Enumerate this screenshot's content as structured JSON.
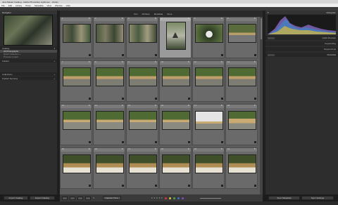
{
  "window": {
    "title": "Jens Master Catalog - Adobe Photoshop Lightroom - Library"
  },
  "menu": [
    "File",
    "Edit",
    "Library",
    "Photo",
    "Metadata",
    "View",
    "Window",
    "Help"
  ],
  "navigator": {
    "title": "Navigator"
  },
  "catalog": {
    "title": "Catalog",
    "items": [
      {
        "label": "All Photographs",
        "count": "",
        "sel": true
      },
      {
        "label": "Quick Collection +",
        "count": ""
      },
      {
        "label": "Previous Import",
        "count": ""
      }
    ]
  },
  "panels": {
    "folders": "Folders",
    "collections": "Collections",
    "publish": "Publish Services"
  },
  "filter": {
    "labels": [
      "Text",
      "Attribute",
      "Metadata",
      "None"
    ]
  },
  "right": {
    "histogram": "Histogram",
    "quick_develop": "Quick Develop",
    "keywording": "Keywording",
    "keyword_list": "Keyword List",
    "metadata": "Metadata"
  },
  "buttons": {
    "import": "Import Catalog",
    "export": "Export Catalog",
    "sync": "Sync Metadata",
    "sync_settings": "Sync Settings",
    "sort": "Capture Time"
  },
  "colors": {
    "accent": "#5e8bd1",
    "select": "#9a9a9a"
  },
  "grid": {
    "rows": [
      [
        {
          "n": "1"
        },
        {
          "n": "2"
        },
        {
          "n": "3"
        },
        {
          "n": "4",
          "sel": true
        },
        {
          "n": "5"
        },
        {
          "n": "6"
        }
      ],
      [
        {
          "n": "7"
        },
        {
          "n": "8"
        },
        {
          "n": "9"
        },
        {
          "n": "10"
        },
        {
          "n": "11"
        },
        {
          "n": "12"
        }
      ],
      [
        {
          "n": "13"
        },
        {
          "n": "14"
        },
        {
          "n": "15"
        },
        {
          "n": "16"
        },
        {
          "n": "17"
        },
        {
          "n": "18"
        }
      ],
      [
        {
          "n": "19"
        },
        {
          "n": "20"
        },
        {
          "n": "21"
        },
        {
          "n": "22"
        },
        {
          "n": "23"
        },
        {
          "n": "24"
        }
      ]
    ]
  }
}
